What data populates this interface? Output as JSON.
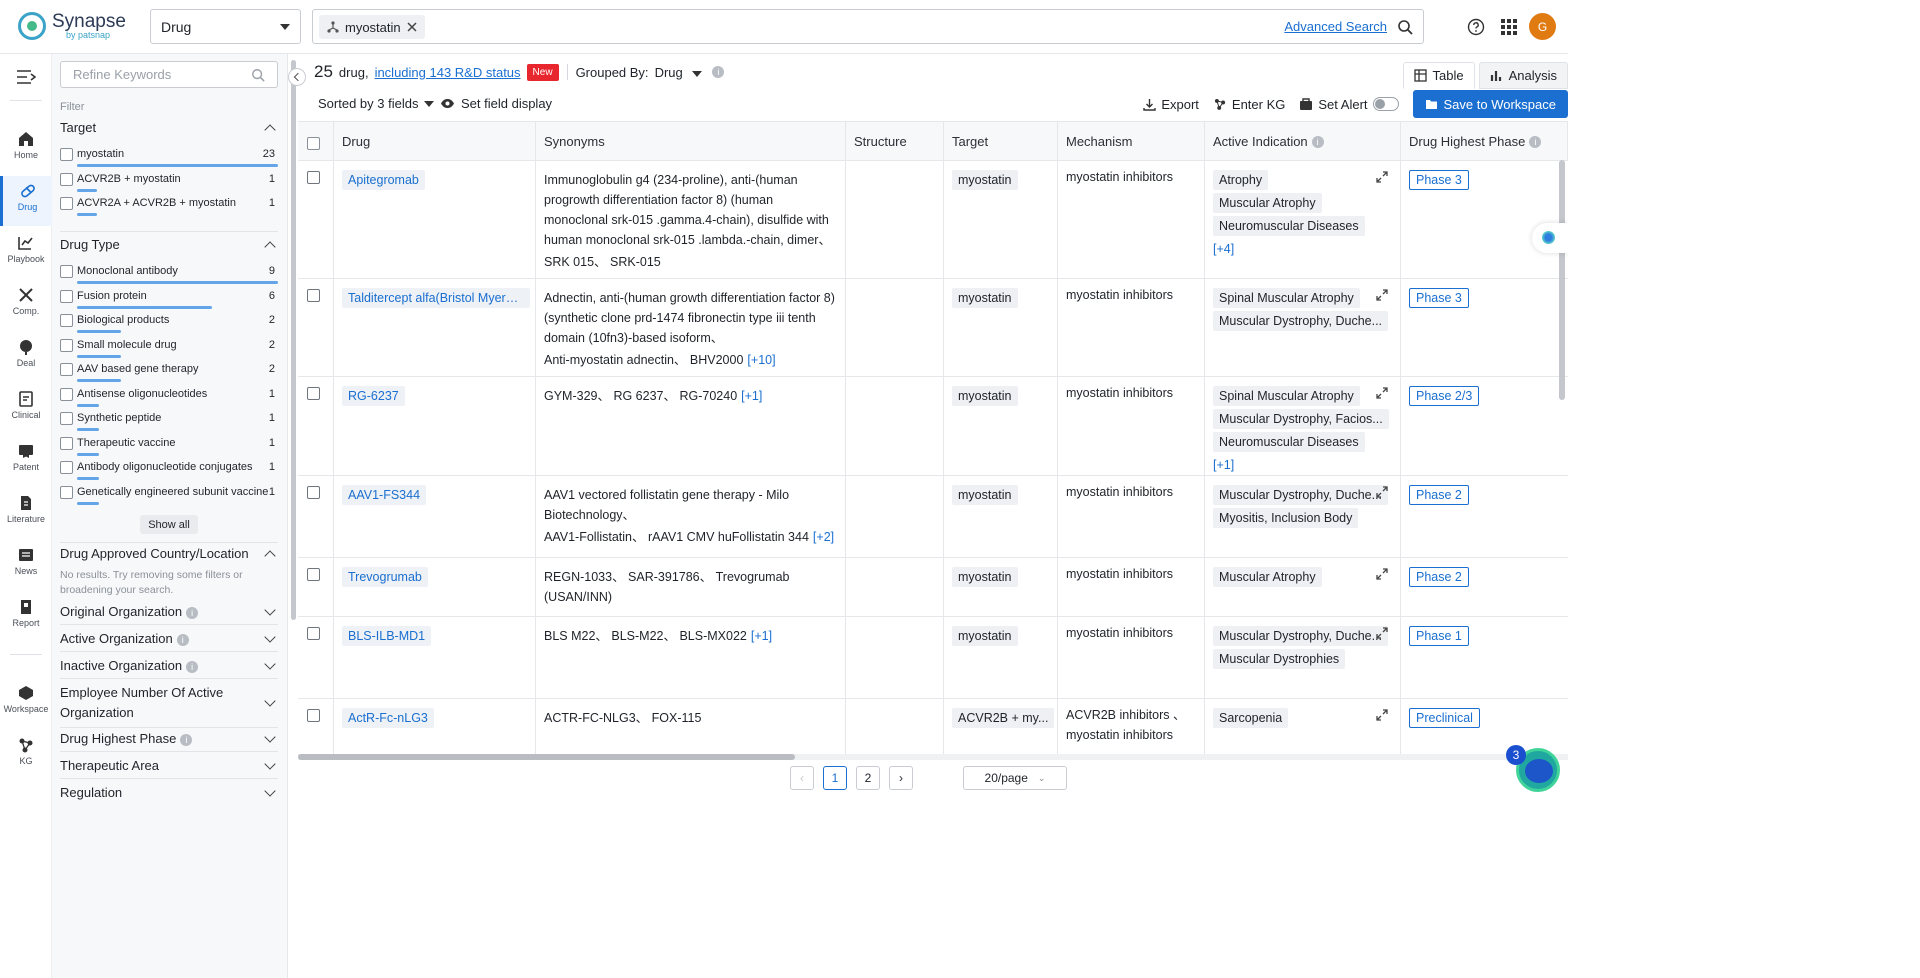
{
  "app": {
    "logo_name": "Synapse",
    "logo_by": "by patsnap",
    "user_initial": "G"
  },
  "topbar": {
    "type_select": "Drug",
    "search_chip": "myostatin",
    "advanced_search": "Advanced Search"
  },
  "nav": {
    "items": [
      {
        "label": "Home",
        "icon": "home-icon"
      },
      {
        "label": "Drug",
        "icon": "pill-icon"
      },
      {
        "label": "Playbook",
        "icon": "playbook-icon"
      },
      {
        "label": "Comp.",
        "icon": "competition-icon"
      },
      {
        "label": "Deal",
        "icon": "deal-icon"
      },
      {
        "label": "Clinical",
        "icon": "clinical-icon"
      },
      {
        "label": "Patent",
        "icon": "patent-icon"
      },
      {
        "label": "Literature",
        "icon": "literature-icon"
      },
      {
        "label": "News",
        "icon": "news-icon"
      },
      {
        "label": "Report",
        "icon": "report-icon"
      },
      {
        "label": "Workspace",
        "icon": "workspace-icon"
      },
      {
        "label": "KG",
        "icon": "kg-icon"
      }
    ]
  },
  "filter": {
    "refine_placeholder": "Refine Keywords",
    "caption": "Filter",
    "target": {
      "title": "Target",
      "items": [
        {
          "name": "myostatin",
          "count": "23",
          "fraction": 1.0
        },
        {
          "name": "ACVR2B + myostatin",
          "count": "1",
          "fraction": 0.04
        },
        {
          "name": "ACVR2A + ACVR2B + myostatin",
          "count": "1",
          "fraction": 0.04
        }
      ]
    },
    "drug_type": {
      "title": "Drug Type",
      "items": [
        {
          "name": "Monoclonal antibody",
          "count": "9",
          "fraction": 1.0
        },
        {
          "name": "Fusion protein",
          "count": "6",
          "fraction": 0.67
        },
        {
          "name": "Biological products",
          "count": "2",
          "fraction": 0.22
        },
        {
          "name": "Small molecule drug",
          "count": "2",
          "fraction": 0.22
        },
        {
          "name": "AAV based gene therapy",
          "count": "2",
          "fraction": 0.22
        },
        {
          "name": "Antisense oligonucleotides",
          "count": "1",
          "fraction": 0.11
        },
        {
          "name": "Synthetic peptide",
          "count": "1",
          "fraction": 0.11
        },
        {
          "name": "Therapeutic vaccine",
          "count": "1",
          "fraction": 0.11
        },
        {
          "name": "Antibody oligonucleotide conjugates",
          "count": "1",
          "fraction": 0.11
        },
        {
          "name": "Genetically engineered subunit vaccine",
          "count": "1",
          "fraction": 0.11
        }
      ],
      "show_all": "Show all"
    },
    "approved_country": {
      "title": "Drug Approved Country/Location",
      "no_results": "No results. Try removing some filters or broadening your search."
    },
    "collapsed": [
      {
        "title": "Original Organization",
        "info": true
      },
      {
        "title": "Active Organization",
        "info": true
      },
      {
        "title": "Inactive Organization",
        "info": true
      },
      {
        "title": "Employee Number Of Active Organization",
        "info": false
      },
      {
        "title": "Drug Highest Phase",
        "info": true
      },
      {
        "title": "Therapeutic Area",
        "info": false
      },
      {
        "title": "Regulation",
        "info": false
      }
    ]
  },
  "summary": {
    "count": "25",
    "unit": "drug,",
    "link": "including 143 R&D status",
    "badge": "New",
    "grouped_label": "Grouped By:",
    "grouped_value": "Drug"
  },
  "view_tabs": {
    "table": "Table",
    "analysis": "Analysis"
  },
  "toolbar": {
    "sorted": "Sorted by 3 fields",
    "set_field": "Set field display",
    "export": "Export",
    "enter_kg": "Enter KG",
    "set_alert": "Set Alert",
    "save": "Save to Workspace"
  },
  "table": {
    "columns": [
      "Drug",
      "Synonyms",
      "Structure",
      "Target",
      "Mechanism",
      "Active Indication",
      "Drug Highest Phase"
    ],
    "rows": [
      {
        "drug": "Apitegromab",
        "synonyms": [
          "Immunoglobulin g4 (234-proline), anti-(human progrowth differentiation factor 8) (human monoclonal srk-015 .gamma.4-chain), disulfide with human monoclonal srk-015 .lambda.-chain, dimer、",
          "SRK 015、 SRK-015"
        ],
        "synonyms_more": "",
        "target": "myostatin",
        "mechanism": [
          "myostatin inhibitors"
        ],
        "indications": [
          "Atrophy",
          "Muscular Atrophy",
          "Neuromuscular Diseases"
        ],
        "indications_more": "[+4]",
        "phase": "Phase 3"
      },
      {
        "drug": "Talditercept alfa(Bristol Myers Sq...",
        "synonyms": [
          "Adnectin, anti-(human growth differentiation factor 8) (synthetic clone prd-1474 fibronectin type iii tenth domain (10fn3)-based isoform、",
          "Anti-myostatin adnectin、 BHV2000"
        ],
        "synonyms_more": "[+10]",
        "target": "myostatin",
        "mechanism": [
          "myostatin inhibitors"
        ],
        "indications": [
          "Spinal Muscular Atrophy",
          "Muscular Dystrophy, Duche..."
        ],
        "indications_more": "",
        "phase": "Phase 3"
      },
      {
        "drug": "RG-6237",
        "synonyms": [
          "GYM-329、 RG 6237、 RG-70240"
        ],
        "synonyms_more": "[+1]",
        "target": "myostatin",
        "mechanism": [
          "myostatin inhibitors"
        ],
        "indications": [
          "Spinal Muscular Atrophy",
          "Muscular Dystrophy, Facios...",
          "Neuromuscular Diseases"
        ],
        "indications_more": "[+1]",
        "phase": "Phase 2/3"
      },
      {
        "drug": "AAV1-FS344",
        "synonyms": [
          "AAV1 vectored follistatin gene therapy - Milo Biotechnology、",
          "AAV1-Follistatin、 rAAV1 CMV huFollistatin 344"
        ],
        "synonyms_more": "[+2]",
        "target": "myostatin",
        "mechanism": [
          "myostatin inhibitors"
        ],
        "indications": [
          "Muscular Dystrophy, Duche...",
          "Myositis, Inclusion Body"
        ],
        "indications_more": "",
        "phase": "Phase 2"
      },
      {
        "drug": "Trevogrumab",
        "synonyms": [
          "REGN-1033、 SAR-391786、 Trevogrumab (USAN/INN)"
        ],
        "synonyms_more": "",
        "target": "myostatin",
        "mechanism": [
          "myostatin inhibitors"
        ],
        "indications": [
          "Muscular Atrophy"
        ],
        "indications_more": "",
        "phase": "Phase 2"
      },
      {
        "drug": "BLS-ILB-MD1",
        "synonyms": [
          "BLS M22、 BLS-M22、 BLS-MX022"
        ],
        "synonyms_more": "[+1]",
        "target": "myostatin",
        "mechanism": [
          "myostatin inhibitors"
        ],
        "indications": [
          "Muscular Dystrophy, Duche...",
          "Muscular Dystrophies"
        ],
        "indications_more": "",
        "phase": "Phase 1"
      },
      {
        "drug": "ActR-Fc-nLG3",
        "synonyms": [
          "ACTR-FC-NLG3、 FOX-115"
        ],
        "synonyms_more": "",
        "target": "ACVR2B + my...",
        "mechanism": [
          "ACVR2B inhibitors 、",
          "myostatin inhibitors"
        ],
        "indications": [
          "Sarcopenia"
        ],
        "indications_more": "",
        "phase": "Preclinical"
      }
    ]
  },
  "pager": {
    "pages": [
      "1",
      "2"
    ],
    "per_page": "20/page"
  },
  "float": {
    "badge": "3"
  },
  "colors": {
    "accent": "#1a6fd0",
    "new_badge": "#e8262d",
    "avatar": "#e07b12"
  }
}
